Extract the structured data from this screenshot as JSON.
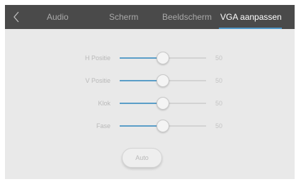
{
  "topbar": {
    "tabs": [
      {
        "label": "Audio"
      },
      {
        "label": "Scherm"
      },
      {
        "label": "Beeldscherm"
      },
      {
        "label": "VGA aanpassen",
        "active": true
      }
    ],
    "back_icon": "chevron-left-icon"
  },
  "settings": {
    "rows": [
      {
        "label": "H Positie",
        "value": 50,
        "value_text": "50",
        "fraction": 0.5
      },
      {
        "label": "V Positie",
        "value": 50,
        "value_text": "50",
        "fraction": 0.5
      },
      {
        "label": "Klok",
        "value": 50,
        "value_text": "50",
        "fraction": 0.5
      },
      {
        "label": "Fase",
        "value": 50,
        "value_text": "50",
        "fraction": 0.5
      }
    ],
    "auto_label": "Auto"
  },
  "colors": {
    "topbar": "#4a4a4a",
    "accent": "#4f97c7",
    "panel": "#e9e9e9"
  }
}
